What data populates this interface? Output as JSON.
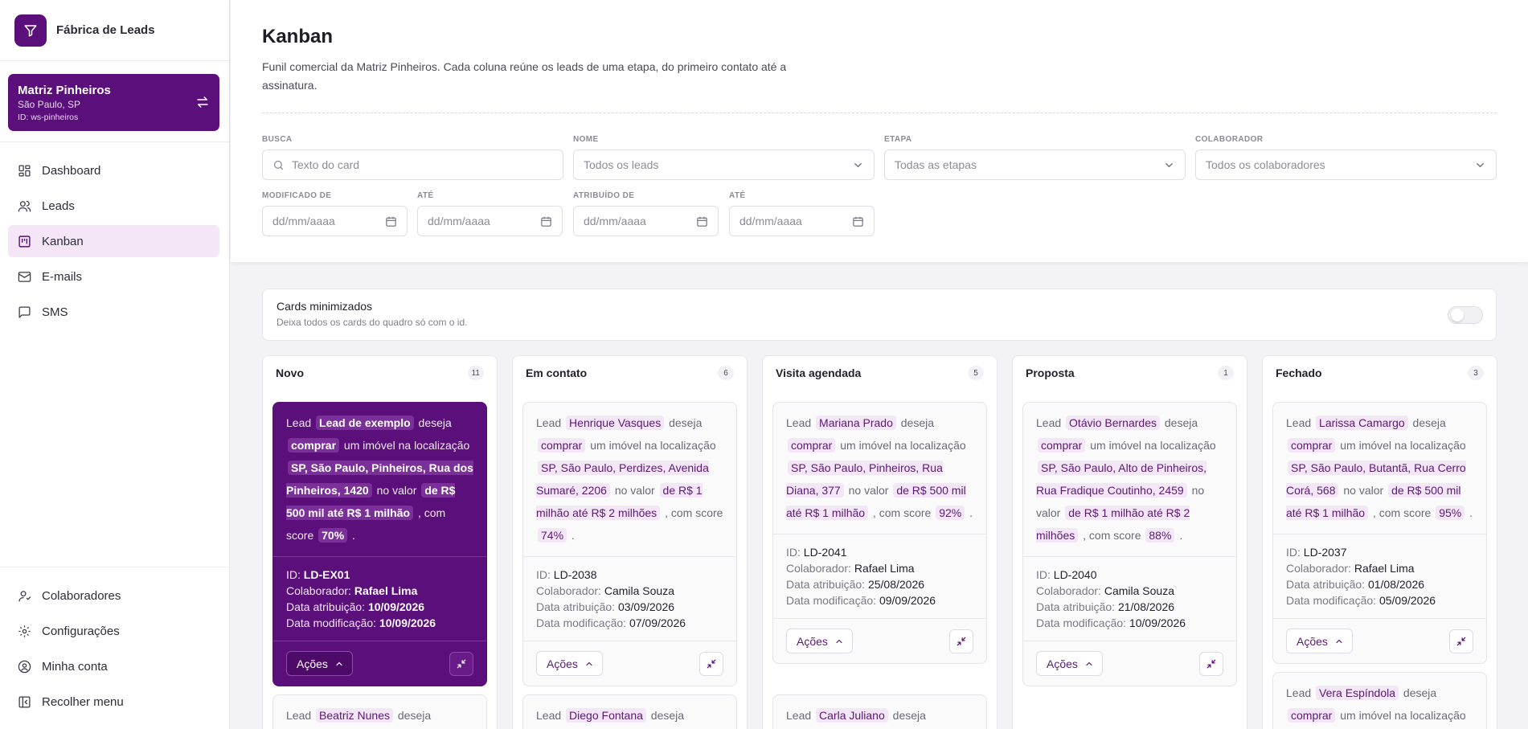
{
  "brand": {
    "name": "Fábrica de Leads",
    "icon": "funnel-icon"
  },
  "workspace": {
    "name": "Matriz Pinheiros",
    "city": "São Paulo, SP",
    "id": "ID: ws-pinheiros"
  },
  "nav": {
    "items": [
      {
        "label": "Dashboard",
        "icon": "dashboard-icon"
      },
      {
        "label": "Leads",
        "icon": "users-icon"
      },
      {
        "label": "Kanban",
        "icon": "kanban-icon",
        "active": true
      },
      {
        "label": "E-mails",
        "icon": "mail-icon"
      },
      {
        "label": "SMS",
        "icon": "chat-icon"
      }
    ],
    "bottom": [
      {
        "label": "Colaboradores",
        "icon": "collaborators-icon"
      },
      {
        "label": "Configurações",
        "icon": "gear-icon"
      },
      {
        "label": "Minha conta",
        "icon": "account-icon"
      },
      {
        "label": "Recolher menu",
        "icon": "collapse-icon"
      }
    ]
  },
  "page": {
    "title": "Kanban",
    "description": "Funil comercial da Matriz Pinheiros. Cada coluna reúne os leads de uma etapa, do primeiro contato até a assinatura."
  },
  "filters": {
    "busca": {
      "label": "BUSCA",
      "placeholder": "Texto do card"
    },
    "nome": {
      "label": "NOME",
      "value": "Todos os leads"
    },
    "etapa": {
      "label": "ETAPA",
      "value": "Todas as etapas"
    },
    "colaborador": {
      "label": "COLABORADOR",
      "value": "Todos os colaboradores"
    },
    "modificado_de": {
      "label": "MODIFICADO DE",
      "placeholder": "dd/mm/aaaa"
    },
    "modificado_ate": {
      "label": "ATÉ",
      "placeholder": "dd/mm/aaaa"
    },
    "atribuido_de": {
      "label": "ATRIBUÍDO DE",
      "placeholder": "dd/mm/aaaa"
    },
    "atribuido_ate": {
      "label": "ATÉ",
      "placeholder": "dd/mm/aaaa"
    }
  },
  "minimized": {
    "title": "Cards minimizados",
    "subtitle": "Deixa todos os cards do quadro só com o id.",
    "enabled": false
  },
  "labels": {
    "lead": "Lead",
    "deseja": "deseja",
    "um_imovel": "um imóvel na localização",
    "no_valor": "no valor",
    "com_score": ", com score",
    "dot": ".",
    "id": "ID:",
    "colaborador": "Colaborador:",
    "data_atribuicao": "Data atribuição:",
    "data_modificacao": "Data modificação:",
    "acoes": "Ações"
  },
  "columns": [
    {
      "title": "Novo",
      "count": "11",
      "cards": [
        {
          "featured": true,
          "name": "Lead de exemplo",
          "action": "comprar",
          "location": "SP, São Paulo, Pinheiros, Rua dos Pinheiros, 1420",
          "value": "de R$ 500 mil até R$ 1 milhão",
          "score": "70%",
          "id": "LD-EX01",
          "colaborador": "Rafael Lima",
          "atribuicao": "10/09/2026",
          "modificacao": "10/09/2026"
        },
        {
          "name": "Beatriz Nunes",
          "partial": true
        }
      ]
    },
    {
      "title": "Em contato",
      "count": "6",
      "cards": [
        {
          "name": "Henrique Vasques",
          "action": "comprar",
          "location": "SP, São Paulo, Perdizes, Avenida Sumaré, 2206",
          "value": "de R$ 1 milhão até R$ 2 milhões",
          "score": "74%",
          "id": "LD-2038",
          "colaborador": "Camila Souza",
          "atribuicao": "03/09/2026",
          "modificacao": "07/09/2026"
        },
        {
          "name": "Diego Fontana",
          "partial": true
        }
      ]
    },
    {
      "title": "Visita agendada",
      "count": "5",
      "cards": [
        {
          "name": "Mariana Prado",
          "action": "comprar",
          "location": "SP, São Paulo, Pinheiros, Rua Diana, 377",
          "value": "de R$ 500 mil até R$ 1 milhão",
          "score": "92%",
          "id": "LD-2041",
          "colaborador": "Rafael Lima",
          "atribuicao": "25/08/2026",
          "modificacao": "09/09/2026"
        },
        {
          "name": "Carla Juliano",
          "partial": true
        }
      ]
    },
    {
      "title": "Proposta",
      "count": "1",
      "cards": [
        {
          "name": "Otávio Bernardes",
          "action": "comprar",
          "location": "SP, São Paulo, Alto de Pinheiros, Rua Fradique Coutinho, 2459",
          "value": "de R$ 1 milhão até R$ 2 milhões",
          "score": "88%",
          "id": "LD-2040",
          "colaborador": "Camila Souza",
          "atribuicao": "21/08/2026",
          "modificacao": "10/09/2026"
        }
      ]
    },
    {
      "title": "Fechado",
      "count": "3",
      "cards": [
        {
          "name": "Larissa Camargo",
          "action": "comprar",
          "location": "SP, São Paulo, Butantã, Rua Cerro Corá, 568",
          "value": "de R$ 500 mil até R$ 1 milhão",
          "score": "95%",
          "id": "LD-2037",
          "colaborador": "Rafael Lima",
          "atribuicao": "01/08/2026",
          "modificacao": "05/09/2026"
        },
        {
          "name": "Vera Espíndola",
          "action": "comprar",
          "partial": true,
          "partial_text": "um imóvel na localização"
        }
      ]
    }
  ]
}
